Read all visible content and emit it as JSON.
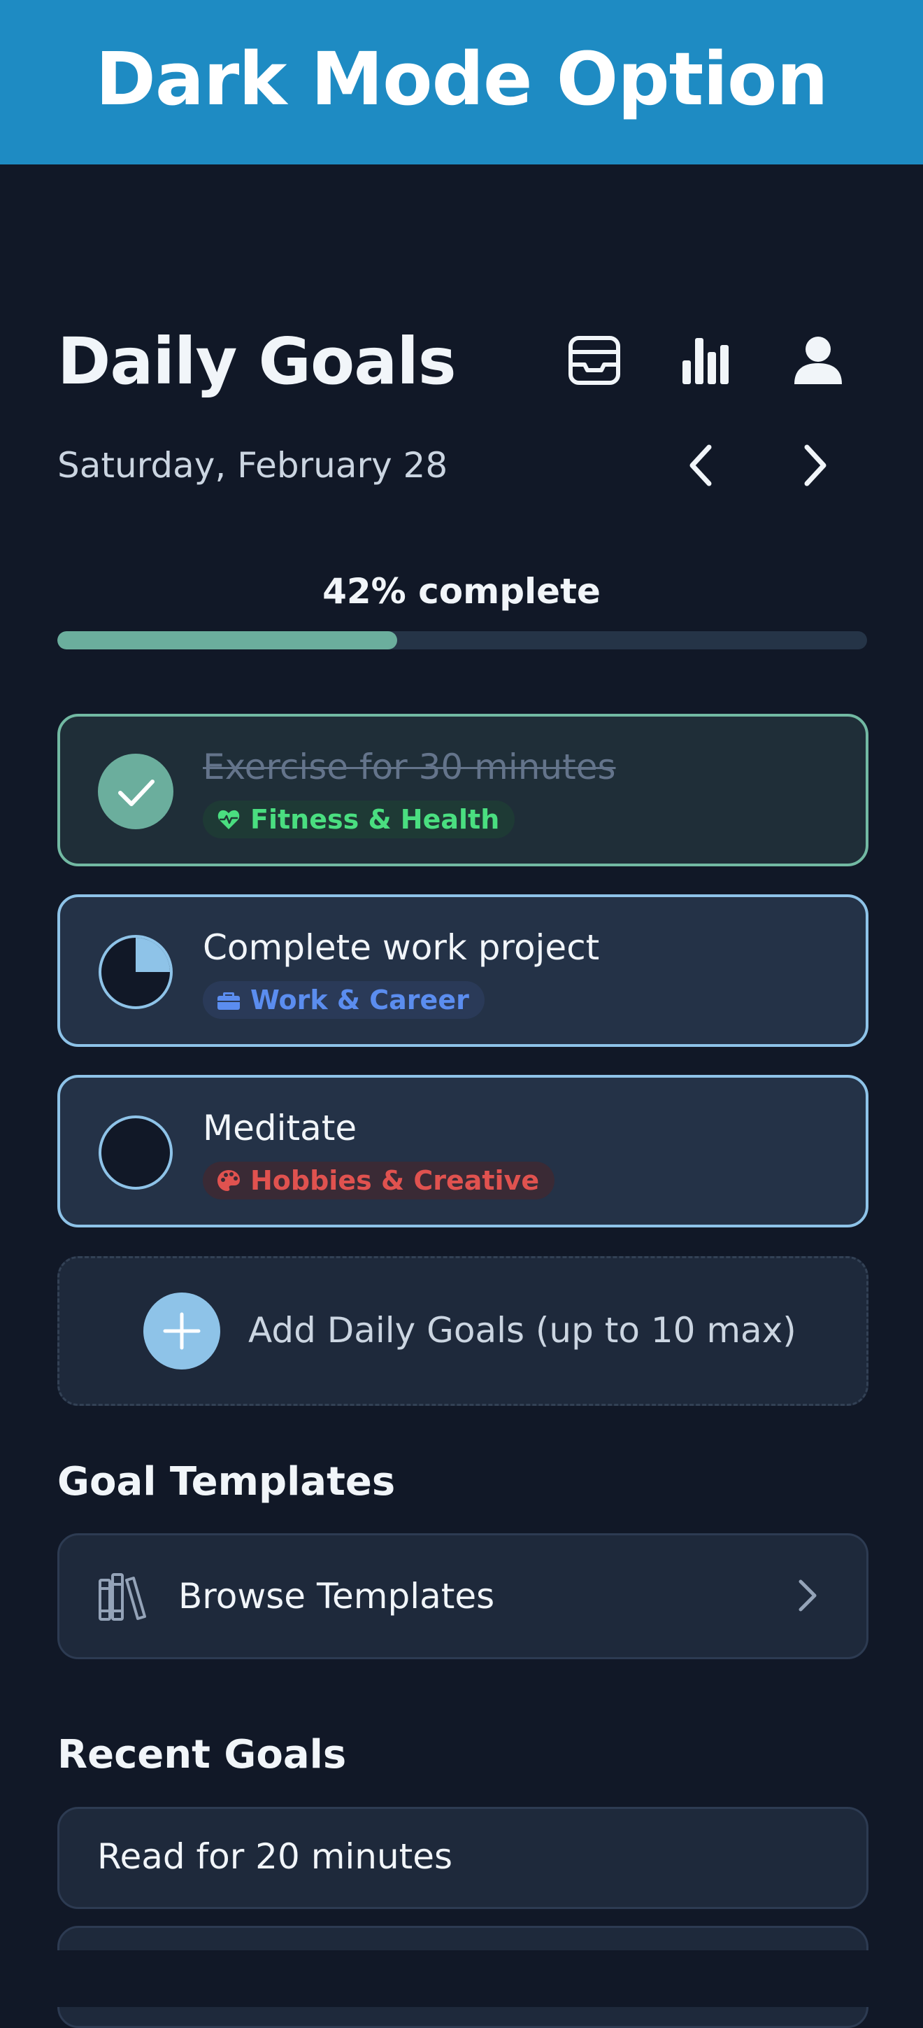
{
  "banner": {
    "title": "Dark Mode Option"
  },
  "header": {
    "title": "Daily Goals",
    "date": "Saturday, February 28",
    "icons": [
      "inbox-tray-icon",
      "bar-chart-icon",
      "user-icon"
    ],
    "nav": [
      "chevron-left-icon",
      "chevron-right-icon"
    ]
  },
  "progress": {
    "label": "42% complete",
    "fraction": 0.42,
    "fill_color": "#6BAE9D",
    "track_color": "#253447"
  },
  "goals": [
    {
      "title": "Exercise for 30 minutes",
      "status": "completed",
      "category": "Fitness & Health",
      "category_icon": "heart-pulse-icon",
      "category_color": "#4ADE80",
      "category_bg": "#1E3A35"
    },
    {
      "title": "Complete work project",
      "status": "partial",
      "progress": 0.25,
      "category": "Work & Career",
      "category_icon": "briefcase-icon",
      "category_color": "#5B8DEF",
      "category_bg": "#2A3A58"
    },
    {
      "title": "Meditate",
      "status": "not-started",
      "category": "Hobbies & Creative",
      "category_icon": "palette-icon",
      "category_color": "#E0524F",
      "category_bg": "#3A2A35"
    }
  ],
  "add_goals": {
    "label": "Add Daily Goals (up to 10 max)"
  },
  "templates": {
    "heading": "Goal Templates",
    "browse_label": "Browse Templates"
  },
  "recent": {
    "heading": "Recent Goals",
    "items": [
      "Read for 20 minutes"
    ]
  },
  "colors": {
    "background": "#111827",
    "accent_blue": "#8EC3E8",
    "accent_green": "#72B9A3",
    "banner": "#1E8BC3"
  }
}
